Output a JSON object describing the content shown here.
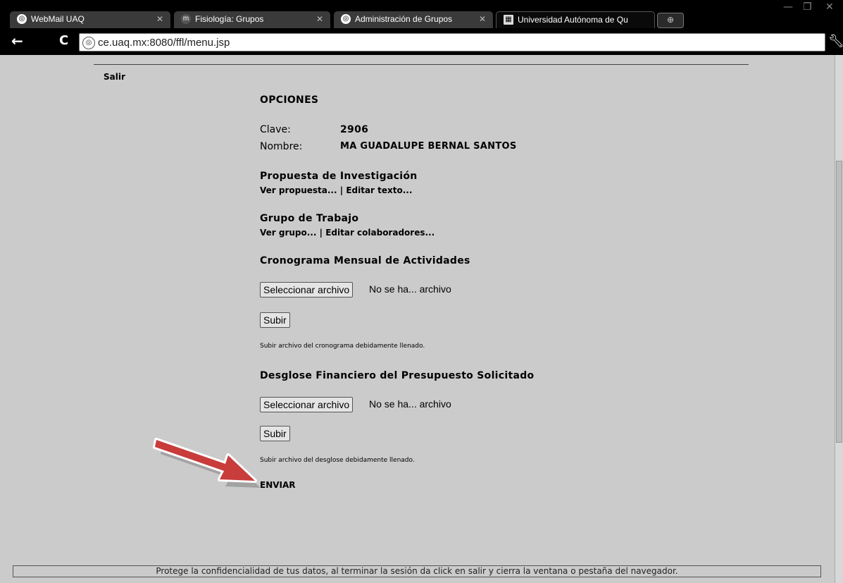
{
  "browser": {
    "tabs": [
      {
        "title": "WebMail UAQ",
        "icon": "globe-icon"
      },
      {
        "title": "Fisiología: Grupos",
        "icon": "moodle-icon"
      },
      {
        "title": "Administración de Grupos",
        "icon": "globe-icon"
      },
      {
        "title": "Universidad Autónoma de Qu",
        "icon": "uaq-logo-icon"
      }
    ],
    "url": "ce.uaq.mx:8080/ffl/menu.jsp"
  },
  "page": {
    "salir": "Salir",
    "heading": "OPCIONES",
    "clave_label": "Clave:",
    "clave_value": "2906",
    "nombre_label": "Nombre:",
    "nombre_value": "MA GUADALUPE BERNAL SANTOS",
    "propuesta": {
      "title": "Propuesta de Investigación",
      "link1": "Ver propuesta...",
      "sep": "|",
      "link2": "Editar texto..."
    },
    "grupo": {
      "title": "Grupo de Trabajo",
      "link1": "Ver grupo...",
      "sep": "|",
      "link2": "Editar colaboradores..."
    },
    "cronograma": {
      "title": "Cronograma Mensual de Actividades",
      "choose_label": "Seleccionar archivo",
      "file_status": "No se ha... archivo",
      "upload_label": "Subir",
      "note": "Subir archivo del cronograma debidamente llenado."
    },
    "desglose": {
      "title": "Desglose Financiero del Presupuesto Solicitado",
      "choose_label": "Seleccionar archivo",
      "file_status": "No se ha... archivo",
      "upload_label": "Subir",
      "note": "Subir archivo del desglose debidamente llenado."
    },
    "enviar": "ENVIAR",
    "footer": "Protege la confidencialidad de tus datos, al terminar la sesión da click en salir y cierra la ventana o pestaña del navegador."
  },
  "colors": {
    "page_bg": "#cbcbcb",
    "arrow": "#c83c3c"
  }
}
